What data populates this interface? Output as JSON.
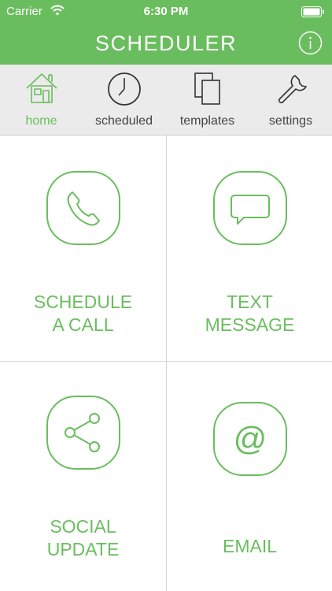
{
  "status_bar": {
    "carrier": "Carrier",
    "time": "6:30 PM"
  },
  "header": {
    "title": "SCHEDULER"
  },
  "tabs": [
    {
      "label": "home",
      "icon": "house-icon",
      "active": true
    },
    {
      "label": "scheduled",
      "icon": "clock-icon",
      "active": false
    },
    {
      "label": "templates",
      "icon": "documents-icon",
      "active": false
    },
    {
      "label": "settings",
      "icon": "wrench-icon",
      "active": false
    }
  ],
  "actions": {
    "call": {
      "line1": "SCHEDULE",
      "line2": "A CALL",
      "icon": "phone-icon"
    },
    "text": {
      "line1": "TEXT",
      "line2": "MESSAGE",
      "icon": "speech-bubble-icon"
    },
    "social": {
      "line1": "SOCIAL",
      "line2": "UPDATE",
      "icon": "share-icon"
    },
    "email": {
      "line1": "EMAIL",
      "icon": "at-sign-icon"
    }
  },
  "colors": {
    "accent": "#6abd5e",
    "tab_background": "#ebebeb",
    "divider": "#d6d6d6"
  }
}
